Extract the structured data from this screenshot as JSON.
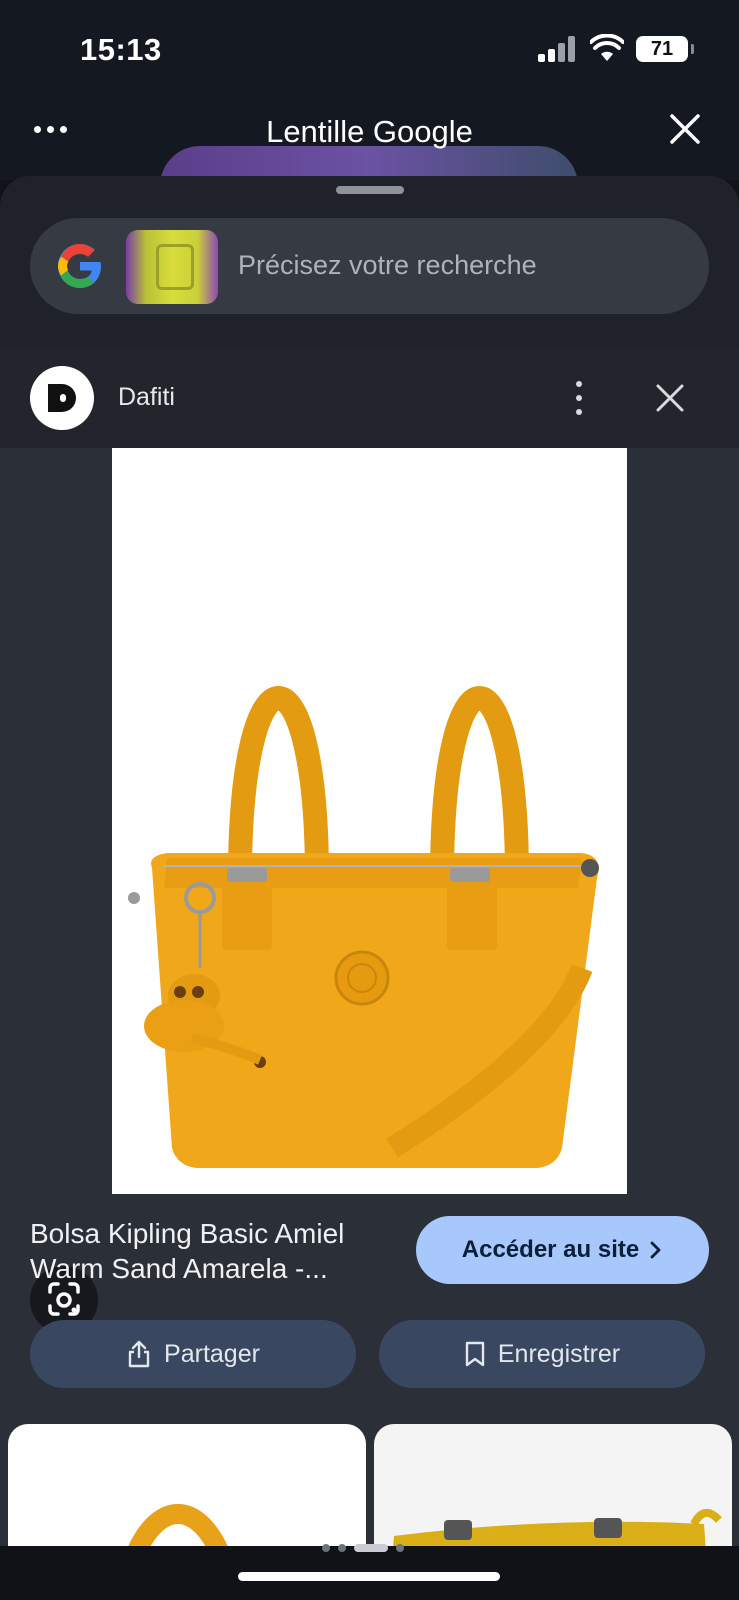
{
  "status_bar": {
    "time": "15:13",
    "battery_level": "71"
  },
  "header": {
    "title": "Lentille Google",
    "more_icon": "more-horizontal-icon",
    "close_icon": "close-icon"
  },
  "search": {
    "placeholder": "Précisez votre recherche"
  },
  "result": {
    "source_name": "Dafiti",
    "product_title": "Bolsa Kipling Basic Amiel Warm Sand Amarela -...",
    "visit_label": "Accéder au site",
    "share_label": "Partager",
    "save_label": "Enregistrer"
  },
  "colors": {
    "accent_button": "#a8c7fa",
    "action_button": "#394860",
    "bag_yellow": "#f0a81a"
  }
}
